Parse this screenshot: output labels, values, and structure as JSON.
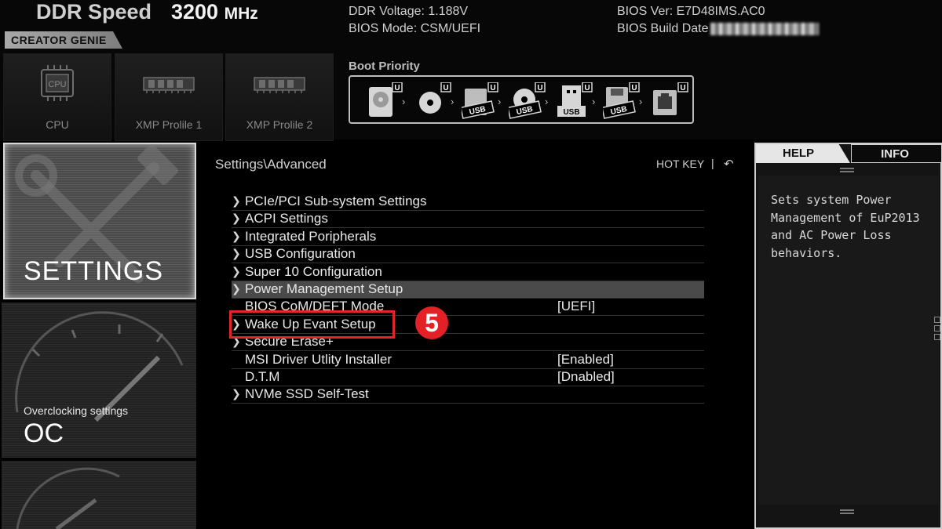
{
  "header": {
    "ddr_label": "DDR Speed",
    "ddr_value": "3200",
    "ddr_unit": "MHz",
    "ddr_voltage": "DDR Voltage: 1.188V",
    "bios_mode": "BIOS Mode: CSM/UEFI",
    "bios_ver": "BIOS Ver: E7D48IMS.AC0",
    "bios_build_label": "BIOS Build Date"
  },
  "creator_genie": {
    "label": "CREATOR GENIE",
    "tiles": [
      {
        "label": "CPU",
        "icon": "cpu-icon"
      },
      {
        "label": "XMP Prolile 1",
        "icon": "memory-icon"
      },
      {
        "label": "XMP Prolile 2",
        "icon": "memory-icon"
      }
    ]
  },
  "boot_priority": {
    "label": "Boot Priority",
    "badge": "U",
    "usb_text": "USB",
    "devices": [
      "hard-disk-icon",
      "optical-disc-icon",
      "usb-drive-icon",
      "usb-disc-icon",
      "usb-key-icon",
      "usb-floppy-icon",
      "network-card-icon"
    ]
  },
  "nav": {
    "settings": "SETTINGS",
    "oc_small": "Overclocking settings",
    "oc_big": "OC"
  },
  "main": {
    "breadcrumb": "Settings\\Advanced",
    "hotkey": "HOT KEY",
    "hotkey_sep": "|",
    "back_glyph": "↶",
    "items": [
      {
        "label": "PCIe/PCI Sub-system Settings",
        "arrow": true,
        "value": ""
      },
      {
        "label": "ACPI Settings",
        "arrow": true,
        "value": ""
      },
      {
        "label": "Integrated Poripherals",
        "arrow": true,
        "value": ""
      },
      {
        "label": "USB Configuration",
        "arrow": true,
        "value": ""
      },
      {
        "label": "Super 10 Configuration",
        "arrow": true,
        "value": ""
      },
      {
        "label": "Power Management Setup",
        "arrow": true,
        "value": ""
      },
      {
        "label": "BIOS CoM/DEFT Mode",
        "arrow": false,
        "value": "[UEFI]"
      },
      {
        "label": "Wake Up Evant Setup",
        "arrow": true,
        "value": ""
      },
      {
        "label": "Secure Erase+",
        "arrow": true,
        "value": ""
      },
      {
        "label": "MSI Driver Utlity Installer",
        "arrow": false,
        "value": "[Enabled]"
      },
      {
        "label": "D.T.M",
        "arrow": false,
        "value": "[Dnabled]"
      },
      {
        "label": "NVMe SSD Self-Test",
        "arrow": true,
        "value": ""
      }
    ],
    "selected_index": 5,
    "annotation_number": "5",
    "colors": {
      "annotation": "#e22026",
      "selected_row": "#4a4a4a"
    }
  },
  "help_panel": {
    "tab_help": "HELP",
    "tab_info": "INFO",
    "text": "Sets system Power Management of EuP2013 and AC Power Loss behaviors."
  }
}
